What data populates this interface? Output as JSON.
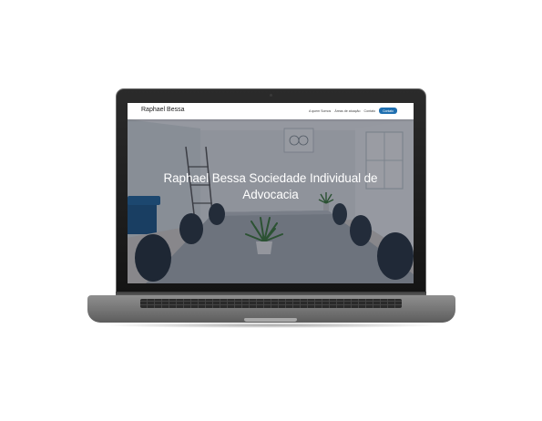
{
  "site": {
    "brand": "Raphael Bessa",
    "nav": {
      "links": [
        "A quem Somos",
        "Áreas de atuação",
        "Contato"
      ],
      "cta_label": "Contato"
    },
    "hero": {
      "title": "Raphael Bessa Sociedade Individual de Advocacia"
    }
  },
  "colors": {
    "accent": "#1f6fb0",
    "laptop_body": "#1a1a1a",
    "overlay": "#141928"
  }
}
